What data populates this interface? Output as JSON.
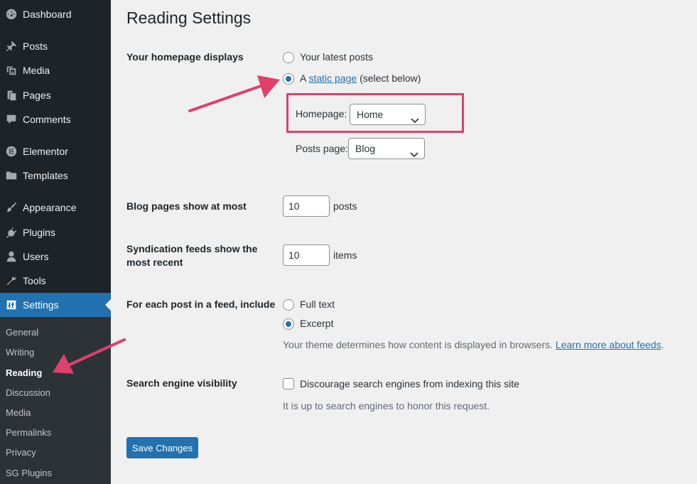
{
  "sidebar": {
    "items": [
      {
        "label": "Dashboard",
        "icon": "dashboard-icon"
      },
      {
        "label": "Posts",
        "icon": "pin-icon"
      },
      {
        "label": "Media",
        "icon": "media-icon"
      },
      {
        "label": "Pages",
        "icon": "pages-icon"
      },
      {
        "label": "Comments",
        "icon": "comment-icon"
      },
      {
        "label": "Elementor",
        "icon": "elementor-icon"
      },
      {
        "label": "Templates",
        "icon": "folder-icon"
      },
      {
        "label": "Appearance",
        "icon": "paintbrush-icon"
      },
      {
        "label": "Plugins",
        "icon": "plugin-icon"
      },
      {
        "label": "Users",
        "icon": "user-icon"
      },
      {
        "label": "Tools",
        "icon": "wrench-icon"
      },
      {
        "label": "Settings",
        "icon": "settings-icon"
      }
    ],
    "submenu": [
      "General",
      "Writing",
      "Reading",
      "Discussion",
      "Media",
      "Permalinks",
      "Privacy",
      "SG Plugins"
    ],
    "current_submenu": "Reading"
  },
  "page": {
    "title": "Reading Settings",
    "homepage_displays": {
      "label": "Your homepage displays",
      "option_latest": "Your latest posts",
      "option_static_prefix": "A",
      "option_static_link": "static page",
      "option_static_suffix": "(select below)",
      "selected": "static page",
      "homepage_label": "Homepage:",
      "homepage_value": "Home",
      "posts_page_label": "Posts page:",
      "posts_page_value": "Blog"
    },
    "blog_pages": {
      "label": "Blog pages show at most",
      "value": "10",
      "unit": "posts"
    },
    "syndication": {
      "label_line1": "Syndication feeds show the",
      "label_line2": "most recent",
      "value": "10",
      "unit": "items"
    },
    "feed_content": {
      "label": "For each post in a feed, include",
      "option_full": "Full text",
      "option_excerpt": "Excerpt",
      "selected": "Excerpt",
      "desc": "Your theme determines how content is displayed in browsers.",
      "desc_link": "Learn more about feeds",
      "desc_end": "."
    },
    "search_visibility": {
      "label": "Search engine visibility",
      "checkbox_label": "Discourage search engines from indexing this site",
      "checked": false,
      "desc": "It is up to search engines to honor this request."
    },
    "save_label": "Save Changes"
  },
  "colors": {
    "accent": "#2271b1",
    "sidebar_bg": "#1d2327",
    "annotation": "#e0406b"
  }
}
